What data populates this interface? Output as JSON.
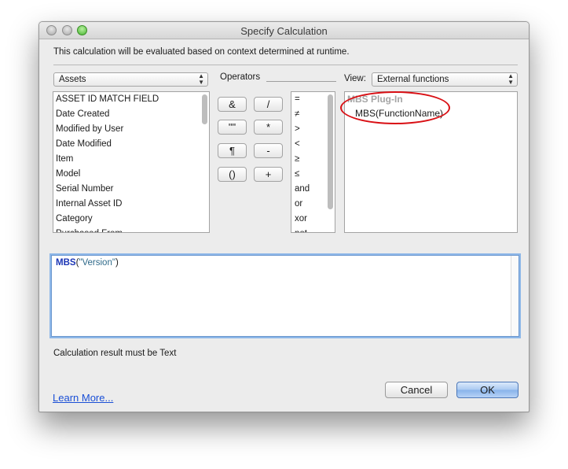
{
  "window": {
    "title": "Specify Calculation",
    "description": "This calculation will be evaluated based on context determined at runtime."
  },
  "table_popup": {
    "selected": "Assets"
  },
  "fields": [
    "ASSET ID MATCH FIELD",
    "Date Created",
    "Modified by User",
    "Date Modified",
    "Item",
    "Model",
    "Serial Number",
    "Internal Asset ID",
    "Category",
    "Purchased From"
  ],
  "operators": {
    "label": "Operators",
    "buttons": [
      "&",
      "/",
      "\"\"",
      "*",
      "¶",
      "-",
      "()",
      "+"
    ],
    "list": [
      "=",
      "≠",
      ">",
      "<",
      "≥",
      "≤",
      "and",
      "or",
      "xor",
      "not"
    ]
  },
  "view": {
    "label": "View:",
    "selected": "External functions"
  },
  "functions": {
    "group": "MBS Plug-In",
    "items": [
      "MBS(FunctionName)"
    ]
  },
  "formula": {
    "function": "MBS",
    "open": "(",
    "argument": "\"Version\"",
    "close": ")"
  },
  "result_text": "Calculation result must be Text",
  "learn_more": "Learn More...",
  "buttons": {
    "cancel": "Cancel",
    "ok": "OK"
  },
  "colors": {
    "annotation_oval": "#d90f14",
    "link": "#1a4fd6",
    "function_keyword": "#1b35b5"
  }
}
